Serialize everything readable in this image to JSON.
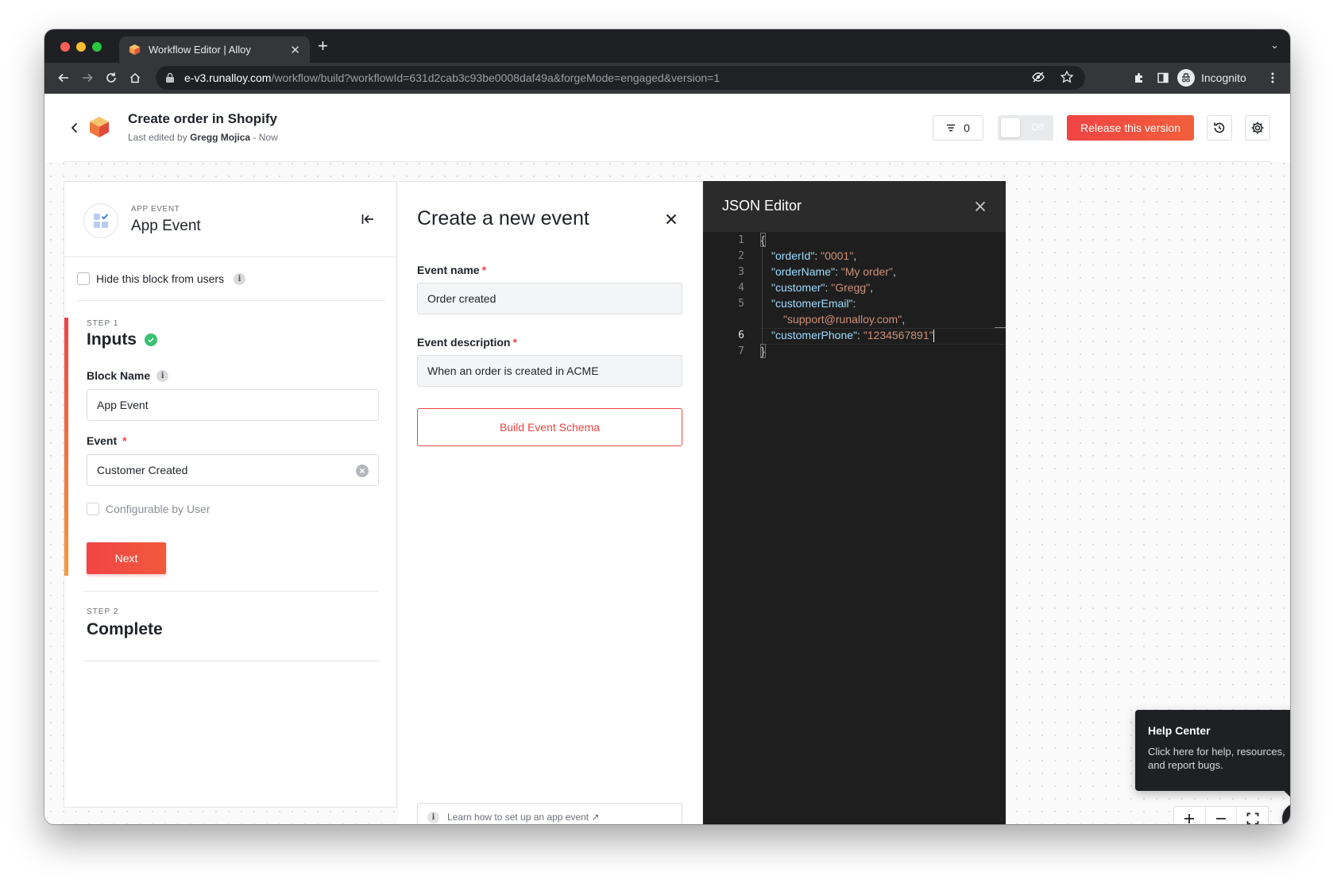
{
  "browser": {
    "tab_title": "Workflow Editor | Alloy",
    "url_host": "e-v3.runalloy.com",
    "url_path": "/workflow/build?workflowId=631d2cab3c93be0008daf49a&forgeMode=engaged&version=1",
    "profile_label": "Incognito"
  },
  "header": {
    "title": "Create order in Shopify",
    "edited_prefix": "Last edited by",
    "edited_by": "Gregg Mojica",
    "edited_suffix": "- Now",
    "filter_count": "0",
    "toggle_label": "Off",
    "release_label": "Release this version"
  },
  "block": {
    "type_label": "APP EVENT",
    "name": "App Event",
    "hide_label": "Hide this block from users",
    "step1": {
      "label": "STEP 1",
      "title": "Inputs",
      "block_name_label": "Block Name",
      "block_name_value": "App Event",
      "event_label": "Event",
      "event_value": "Customer Created",
      "configurable_label": "Configurable by User",
      "next_label": "Next"
    },
    "step2": {
      "label": "STEP 2",
      "title": "Complete"
    }
  },
  "event_form": {
    "title": "Create a new event",
    "name_label": "Event name",
    "name_value": "Order created",
    "desc_label": "Event description",
    "desc_value": "When an order is created in ACME",
    "build_label": "Build Event Schema",
    "learn_label": "Learn how to set up an app event ↗"
  },
  "json_editor": {
    "title": "JSON Editor",
    "line_numbers": [
      "1",
      "2",
      "3",
      "4",
      "5",
      "6",
      "7"
    ],
    "open_brace": "{",
    "close_brace": "}",
    "rows": [
      {
        "key": "\"orderId\"",
        "value": "\"0001\"",
        "trail": ","
      },
      {
        "key": "\"orderName\"",
        "value": "\"My order\"",
        "trail": ","
      },
      {
        "key": "\"customer\"",
        "value": "\"Gregg\"",
        "trail": ","
      },
      {
        "key": "\"customerEmail\"",
        "value": "\"support@runalloy.com\"",
        "trail": ","
      },
      {
        "key": "\"customerPhone\"",
        "value": "\"1234567891\"",
        "trail": ""
      }
    ],
    "colon": ": "
  },
  "help": {
    "title": "Help Center",
    "body": "Click here for help, resources, and report bugs.",
    "fab_label": "?"
  },
  "colors": {
    "accent": "#ef4444",
    "json_key": "#9cdcfe",
    "json_string": "#ce9178",
    "success": "#38c172"
  },
  "icons": [
    "alloy-logo-icon",
    "back-arrow-icon",
    "filter-icon",
    "history-icon",
    "gear-icon",
    "collapse-left-icon",
    "close-icon",
    "info-icon",
    "check-circle-icon",
    "clear-circle-icon",
    "plus-icon",
    "minus-icon",
    "fullscreen-icon"
  ]
}
